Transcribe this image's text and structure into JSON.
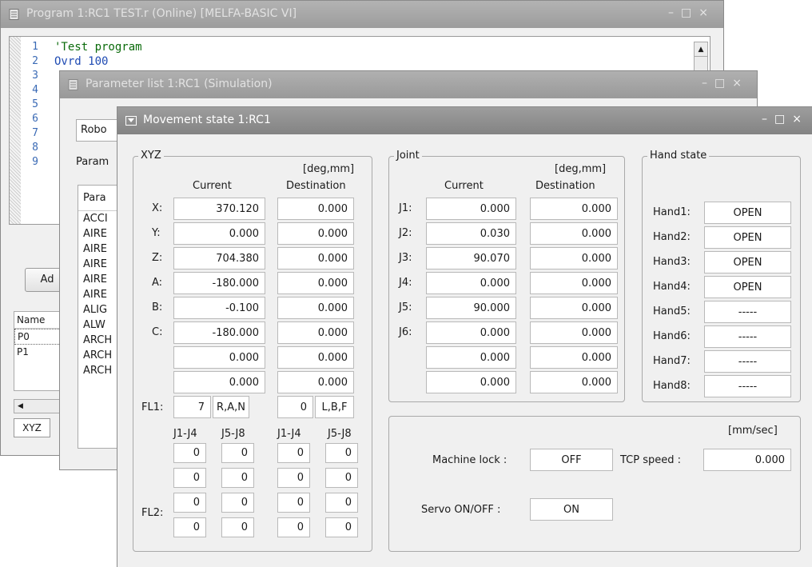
{
  "program_window": {
    "title": "Program 1:RC1 TEST.r (Online)   [MELFA-BASIC VI]",
    "line_numbers": [
      "1",
      "2",
      "3",
      "4",
      "5",
      "6",
      "7",
      "8",
      "9"
    ],
    "code_line_1": "'Test program",
    "code_line_2": "Ovrd 100",
    "left_panel": {
      "add_button": "Ad",
      "name_header": "Name",
      "rows": [
        "P0",
        "P1"
      ],
      "tab_xyz": "XYZ"
    }
  },
  "param_window": {
    "title": "Parameter list 1:RC1 (Simulation)",
    "robot_select": "Robo",
    "param_label": "Param",
    "col_header": "Para",
    "items": [
      "ACCI",
      "AIRE",
      "AIRE",
      "AIRE",
      "AIRE",
      "AIRE",
      "ALIG",
      "ALW",
      "ARCH",
      "ARCH",
      "ARCH"
    ]
  },
  "movement_window": {
    "title": "Movement state 1:RC1",
    "xyz": {
      "group_title": "XYZ",
      "unit": "[deg,mm]",
      "col_current": "Current",
      "col_destination": "Destination",
      "rows": [
        {
          "label": "X:",
          "current": "370.120",
          "destination": "0.000"
        },
        {
          "label": "Y:",
          "current": "0.000",
          "destination": "0.000"
        },
        {
          "label": "Z:",
          "current": "704.380",
          "destination": "0.000"
        },
        {
          "label": "A:",
          "current": "-180.000",
          "destination": "0.000"
        },
        {
          "label": "B:",
          "current": "-0.100",
          "destination": "0.000"
        },
        {
          "label": "C:",
          "current": "-180.000",
          "destination": "0.000"
        },
        {
          "label": "",
          "current": "0.000",
          "destination": "0.000"
        },
        {
          "label": "",
          "current": "0.000",
          "destination": "0.000"
        }
      ],
      "fl1_label": "FL1:",
      "fl1_current_num": "7",
      "fl1_current_flags": "R,A,N",
      "fl1_dest_num": "0",
      "fl1_dest_flags": "L,B,F",
      "fl2_label": "FL2:",
      "fl2_headers": [
        "J1-J4",
        "J5-J8",
        "J1-J4",
        "J5-J8"
      ],
      "fl2_rows": [
        [
          "0",
          "0",
          "0",
          "0"
        ],
        [
          "0",
          "0",
          "0",
          "0"
        ],
        [
          "0",
          "0",
          "0",
          "0"
        ],
        [
          "0",
          "0",
          "0",
          "0"
        ]
      ]
    },
    "joint": {
      "group_title": "Joint",
      "unit": "[deg,mm]",
      "col_current": "Current",
      "col_destination": "Destination",
      "rows": [
        {
          "label": "J1:",
          "current": "0.000",
          "destination": "0.000"
        },
        {
          "label": "J2:",
          "current": "0.030",
          "destination": "0.000"
        },
        {
          "label": "J3:",
          "current": "90.070",
          "destination": "0.000"
        },
        {
          "label": "J4:",
          "current": "0.000",
          "destination": "0.000"
        },
        {
          "label": "J5:",
          "current": "90.000",
          "destination": "0.000"
        },
        {
          "label": "J6:",
          "current": "0.000",
          "destination": "0.000"
        },
        {
          "label": "",
          "current": "0.000",
          "destination": "0.000"
        },
        {
          "label": "",
          "current": "0.000",
          "destination": "0.000"
        }
      ]
    },
    "hand": {
      "group_title": "Hand state",
      "rows": [
        {
          "label": "Hand1:",
          "value": "OPEN"
        },
        {
          "label": "Hand2:",
          "value": "OPEN"
        },
        {
          "label": "Hand3:",
          "value": "OPEN"
        },
        {
          "label": "Hand4:",
          "value": "OPEN"
        },
        {
          "label": "Hand5:",
          "value": "-----"
        },
        {
          "label": "Hand6:",
          "value": "-----"
        },
        {
          "label": "Hand7:",
          "value": "-----"
        },
        {
          "label": "Hand8:",
          "value": "-----"
        }
      ]
    },
    "status": {
      "unit": "[mm/sec]",
      "machine_lock_label": "Machine lock :",
      "machine_lock_value": "OFF",
      "tcp_speed_label": "TCP speed :",
      "tcp_speed_value": "0.000",
      "servo_label": "Servo ON/OFF :",
      "servo_value": "ON"
    }
  }
}
